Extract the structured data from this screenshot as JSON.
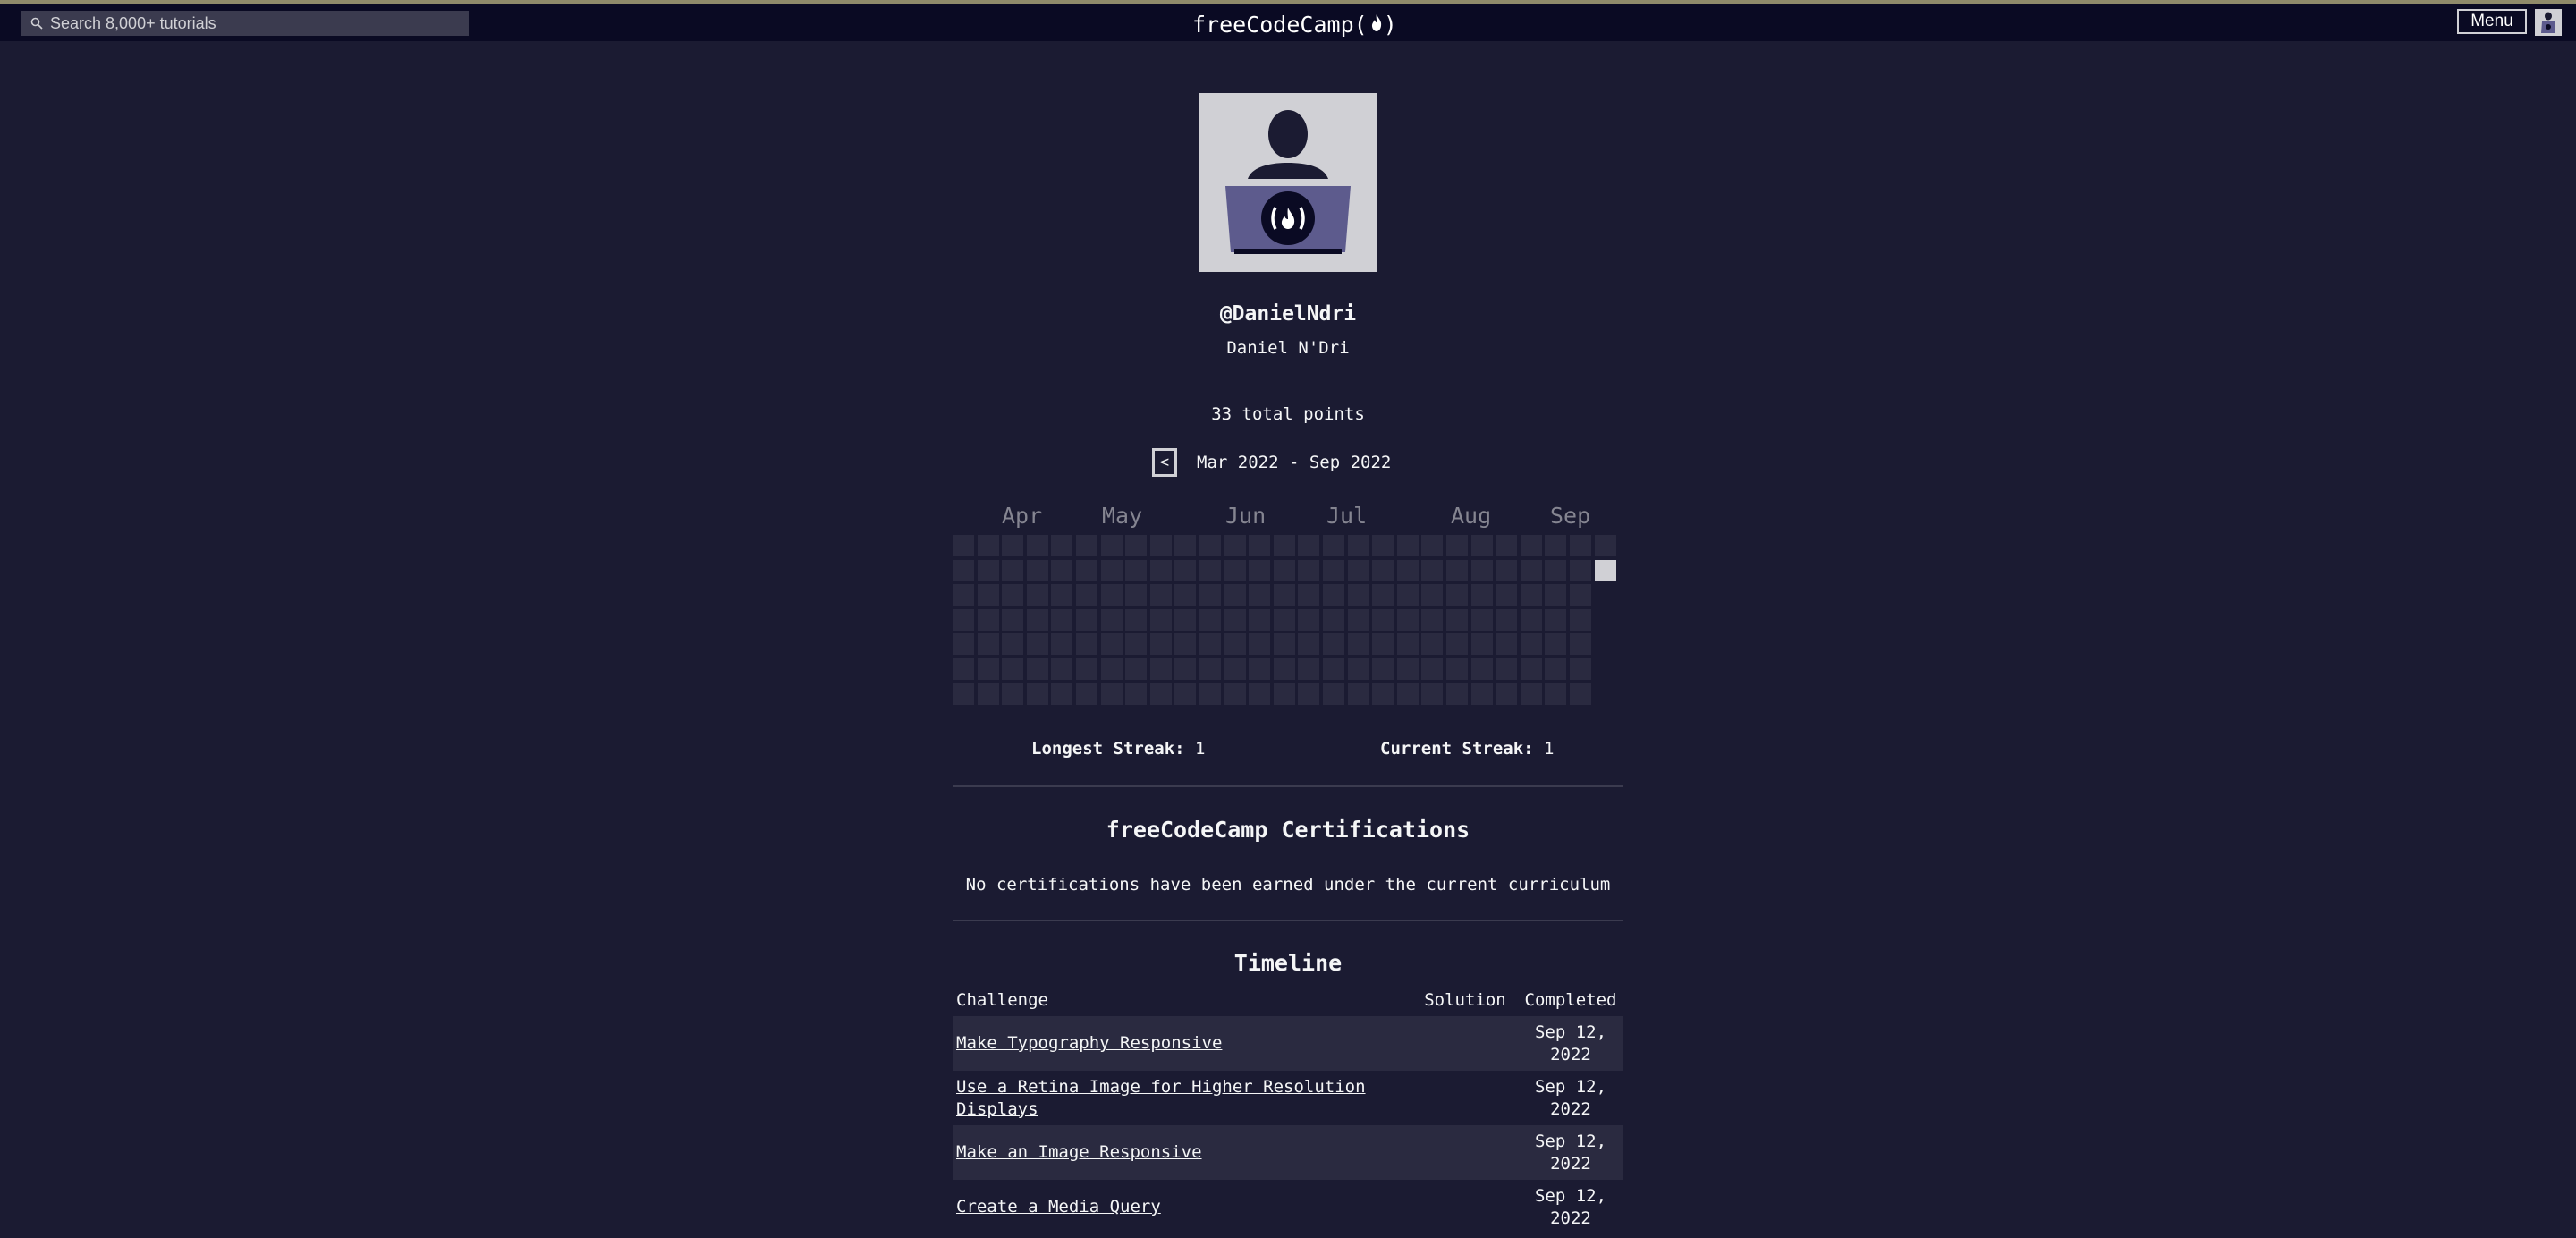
{
  "navbar": {
    "search_placeholder": "Search 8,000+ tutorials",
    "brand": "freeCodeCamp",
    "brand_paren_open": "(",
    "brand_paren_close": ")",
    "menu_label": "Menu"
  },
  "profile": {
    "username": "@DanielNdri",
    "full_name": "Daniel N'Dri",
    "points": "33 total points"
  },
  "heatmap": {
    "prev_label": "<",
    "range": "Mar 2022 - Sep 2022",
    "months": [
      "Apr",
      "May",
      "Jun",
      "Jul",
      "Aug",
      "Sep"
    ],
    "active_cells": [
      {
        "week": 26,
        "day": 1
      }
    ]
  },
  "streaks": {
    "longest_label": "Longest Streak:",
    "longest_value": "1",
    "current_label": "Current Streak:",
    "current_value": "1"
  },
  "certifications": {
    "title": "freeCodeCamp Certifications",
    "message": "No certifications have been earned under the current curriculum"
  },
  "timeline": {
    "title": "Timeline",
    "headers": {
      "challenge": "Challenge",
      "solution": "Solution",
      "completed": "Completed"
    },
    "rows": [
      {
        "challenge": "Make Typography Responsive",
        "solution": "",
        "completed": "Sep 12, 2022"
      },
      {
        "challenge": "Use a Retina Image for Higher Resolution Displays",
        "solution": "",
        "completed": "Sep 12, 2022"
      },
      {
        "challenge": "Make an Image Responsive",
        "solution": "",
        "completed": "Sep 12, 2022"
      },
      {
        "challenge": "Create a Media Query",
        "solution": "",
        "completed": "Sep 12, 2022"
      }
    ]
  },
  "colors": {
    "background": "#1b1b32",
    "navbar": "#0a0a23",
    "cell_empty": "#2a2a40",
    "cell_active": "#d0d0d5"
  }
}
